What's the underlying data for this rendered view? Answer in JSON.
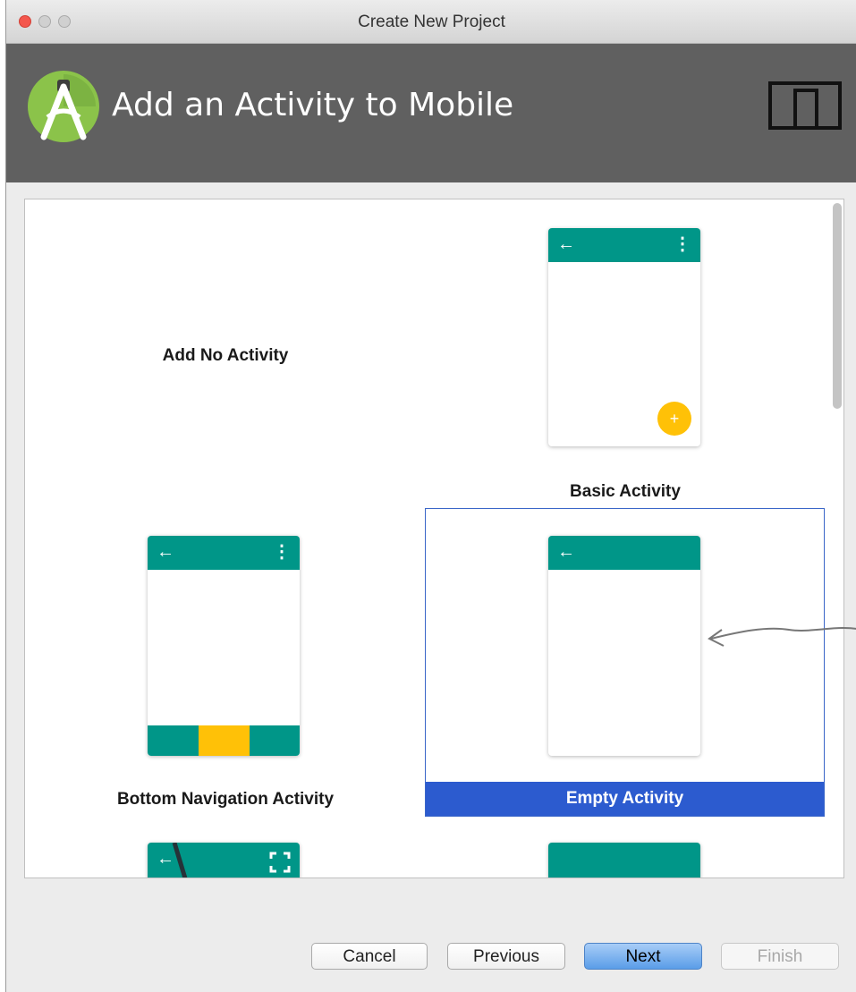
{
  "window": {
    "title": "Create New Project"
  },
  "header": {
    "title": "Add an Activity to Mobile",
    "logo_icon": "android-studio-logo-icon",
    "device_icon": "phone-tablet-icon"
  },
  "gallery": {
    "selected": "Empty Activity",
    "items": [
      {
        "label": "Add No Activity"
      },
      {
        "label": "Basic Activity"
      },
      {
        "label": "Bottom Navigation Activity"
      },
      {
        "label": "Empty Activity"
      }
    ]
  },
  "buttons": {
    "cancel": "Cancel",
    "previous": "Previous",
    "next": "Next",
    "finish": "Finish"
  },
  "colors": {
    "appbar": "#009688",
    "accent": "#ffc107",
    "selection": "#2c5bcf",
    "header_bg": "#606060"
  },
  "glyphs": {
    "back": "←",
    "overflow": "⋮",
    "fab": "+"
  }
}
